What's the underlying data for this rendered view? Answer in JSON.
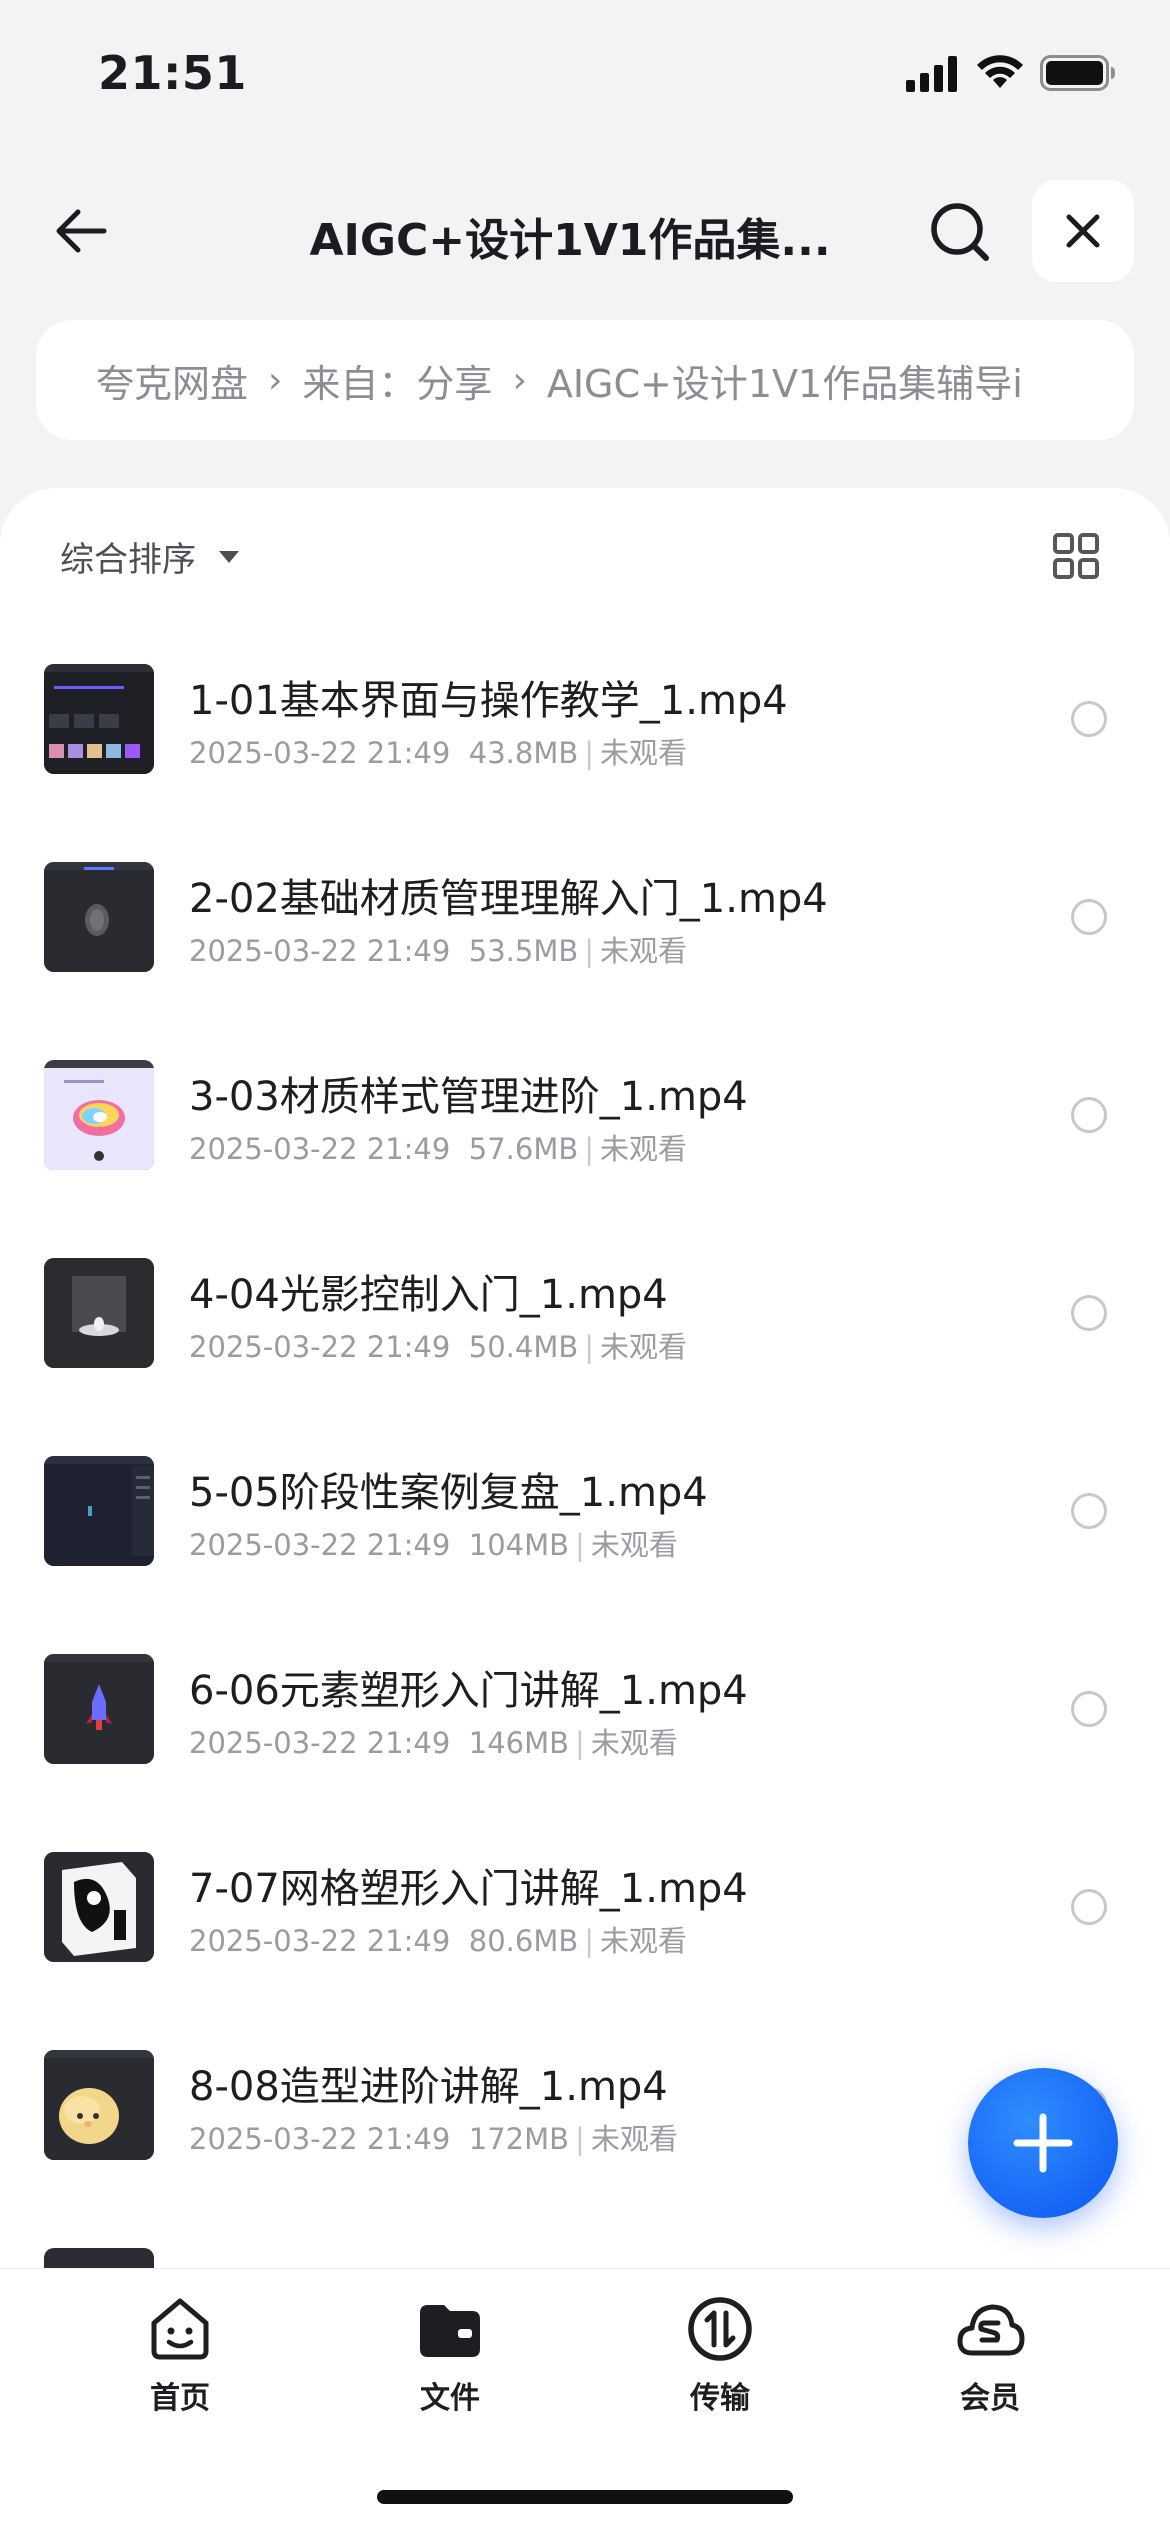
{
  "status_bar": {
    "time": "21:51"
  },
  "nav": {
    "title": "AIGC+设计1V1作品集..."
  },
  "breadcrumb": {
    "items": [
      "夸克网盘",
      "来自：分享",
      "AIGC+设计1V1作品集辅导i"
    ],
    "separator": "›"
  },
  "toolbar": {
    "sort_label": "综合排序"
  },
  "files": [
    {
      "name": "1-01基本界面与操作教学_1.mp4",
      "date": "2025-03-22 21:49",
      "size": "43.8MB",
      "status": "未观看"
    },
    {
      "name": "2-02基础材质管理理解入门_1.mp4",
      "date": "2025-03-22 21:49",
      "size": "53.5MB",
      "status": "未观看"
    },
    {
      "name": "3-03材质样式管理进阶_1.mp4",
      "date": "2025-03-22 21:49",
      "size": "57.6MB",
      "status": "未观看"
    },
    {
      "name": "4-04光影控制入门_1.mp4",
      "date": "2025-03-22 21:49",
      "size": "50.4MB",
      "status": "未观看"
    },
    {
      "name": "5-05阶段性案例复盘_1.mp4",
      "date": "2025-03-22 21:49",
      "size": "104MB",
      "status": "未观看"
    },
    {
      "name": "6-06元素塑形入门讲解_1.mp4",
      "date": "2025-03-22 21:49",
      "size": "146MB",
      "status": "未观看"
    },
    {
      "name": "7-07网格塑形入门讲解_1.mp4",
      "date": "2025-03-22 21:49",
      "size": "80.6MB",
      "status": "未观看"
    },
    {
      "name": "8-08造型进阶讲解_1.mp4",
      "date": "2025-03-22 21:49",
      "size": "172MB",
      "status": "未观看"
    }
  ],
  "tabs": [
    {
      "label": "首页",
      "icon": "home-face-icon"
    },
    {
      "label": "文件",
      "icon": "folder-icon"
    },
    {
      "label": "传输",
      "icon": "transfer-icon"
    },
    {
      "label": "会员",
      "icon": "vip-cloud-icon"
    }
  ],
  "colors": {
    "accent": "#0b57f0",
    "text": "#1d1e22",
    "muted": "#9a9ca2",
    "background": "#f2f3f5"
  }
}
